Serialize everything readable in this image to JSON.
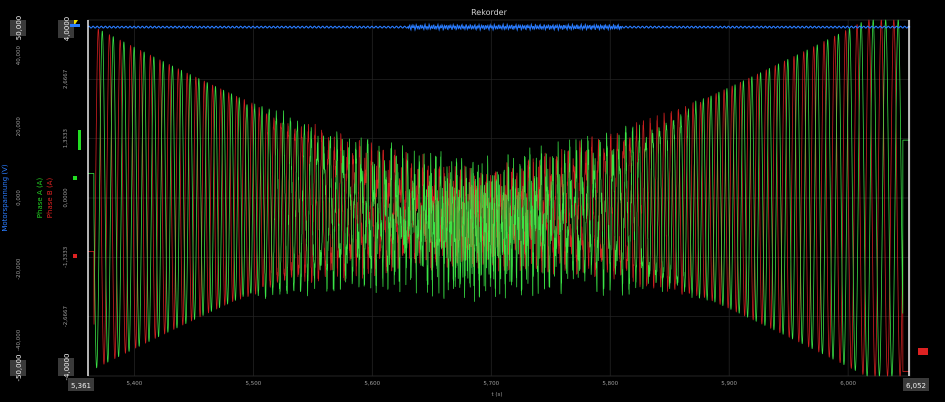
{
  "chart_data": {
    "type": "line",
    "title": "Rekorder",
    "xlabel": "t (s)",
    "xlim": [
      5.361,
      6.052
    ],
    "x_ticks": [
      "5,400",
      "5,500",
      "5,600",
      "5,700",
      "5,800",
      "5,900",
      "6,000"
    ],
    "x_tick_values": [
      5.4,
      5.5,
      5.6,
      5.7,
      5.8,
      5.9,
      6.0
    ],
    "cursor_left": "5,361",
    "cursor_right": "6,052",
    "grid": true,
    "axes": [
      {
        "name": "Motorspannung (V)",
        "color": "#2a7cff",
        "ylim": [
          -50,
          50
        ],
        "ticks": [
          "50,000",
          "40,000",
          "20,000",
          "0,000",
          "-20,000",
          "-40,000",
          "-50,000"
        ]
      },
      {
        "name": "Phase A (A)",
        "color": "#22cc22",
        "ylim": [
          -4,
          4
        ],
        "ticks": [
          "4,0000",
          "2,6667",
          "1,3333",
          "0,0000",
          "-1,3333",
          "-2,6667",
          "-4,0000"
        ]
      },
      {
        "name": "Phase B (A)",
        "color": "#dd2222",
        "ylim": [
          -4,
          4
        ]
      }
    ],
    "series": [
      {
        "name": "Motorspannung (V)",
        "color": "#2a7cff",
        "summary": "near-constant around 48 V with small ripple"
      },
      {
        "name": "Phase A (A)",
        "color": "#33ee44",
        "summary": "sinusoidal, amplitude ~4 A at ends, narrowing to ~0.5 A near t=5.68 s, frequency rising toward the middle"
      },
      {
        "name": "Phase B (A)",
        "color": "#dd2222",
        "summary": "sinusoidal, phase-shifted from Phase A, same envelope"
      }
    ]
  }
}
